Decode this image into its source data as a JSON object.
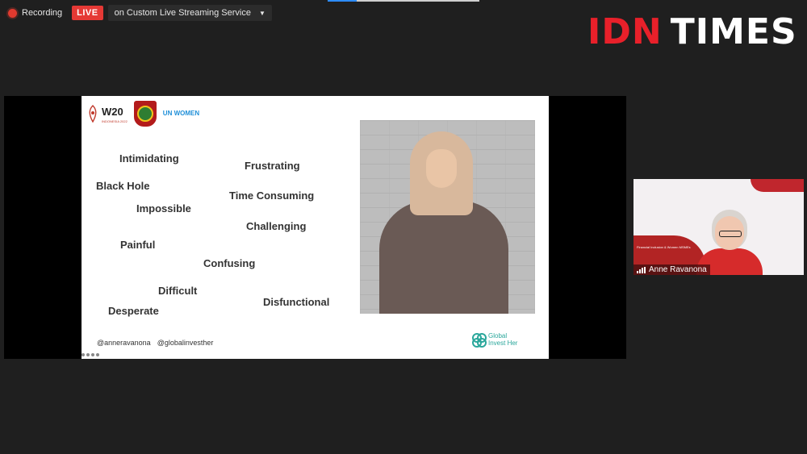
{
  "recording": {
    "label": "Recording",
    "live_badge": "LIVE",
    "stream_service": "on Custom Live Streaming Service"
  },
  "logo": {
    "part1": "IDN",
    "part2": "TIMES"
  },
  "slide": {
    "logos": {
      "w20": "W20",
      "w20_sub": "INDONESIA 2022",
      "un_women": "UN WOMEN"
    },
    "words": [
      "Intimidating",
      "Frustrating",
      "Black Hole",
      "Time Consuming",
      "Impossible",
      "Challenging",
      "Painful",
      "Confusing",
      "Difficult",
      "Disfunctional",
      "Desperate"
    ],
    "footer_handles": [
      "@anneravanona",
      "@globalinvesther"
    ],
    "brand": {
      "line1": "Global",
      "line2": "Invest Her"
    }
  },
  "participant": {
    "name": "Anne Ravanona",
    "slide_title": "Financial Inclusion & Women MSMEs"
  },
  "colors": {
    "live": "#e53935",
    "idn_red": "#e8202a",
    "background": "#1f1f1f",
    "brand_teal": "#2aa79b"
  }
}
